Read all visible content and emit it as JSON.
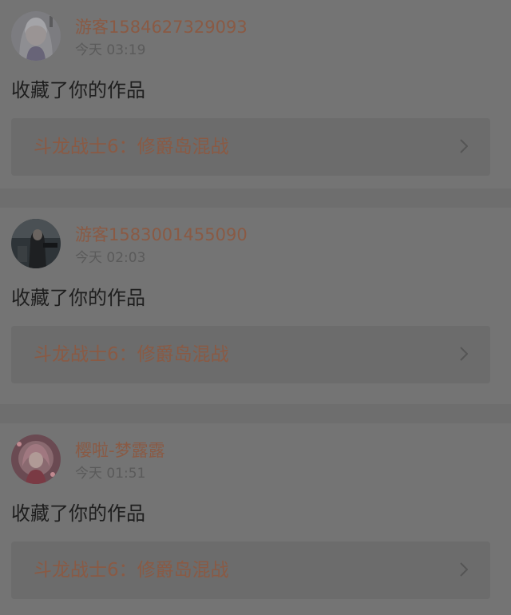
{
  "notifications": [
    {
      "username": "游客1584627329093",
      "time": "今天 03:19",
      "action": "收藏了你的作品",
      "work_title": "斗龙战士6：修爵岛混战",
      "avatar_icon": "anime-girl-avatar"
    },
    {
      "username": "游客1583001455090",
      "time": "今天 02:03",
      "action": "收藏了你的作品",
      "work_title": "斗龙战士6：修爵岛混战",
      "avatar_icon": "dark-character-avatar"
    },
    {
      "username": "樱啦-梦露露",
      "time": "今天 01:51",
      "action": "收藏了你的作品",
      "work_title": "斗龙战士6：修爵岛混战",
      "avatar_icon": "pink-character-avatar"
    }
  ],
  "colors": {
    "overlay_background": "#6e6e6e",
    "card_background": "#747474",
    "link_box_background": "#6c6c6c",
    "accent_text": "#8a5a44",
    "primary_text": "#1e1e1e",
    "secondary_text": "#5a5a5a"
  }
}
